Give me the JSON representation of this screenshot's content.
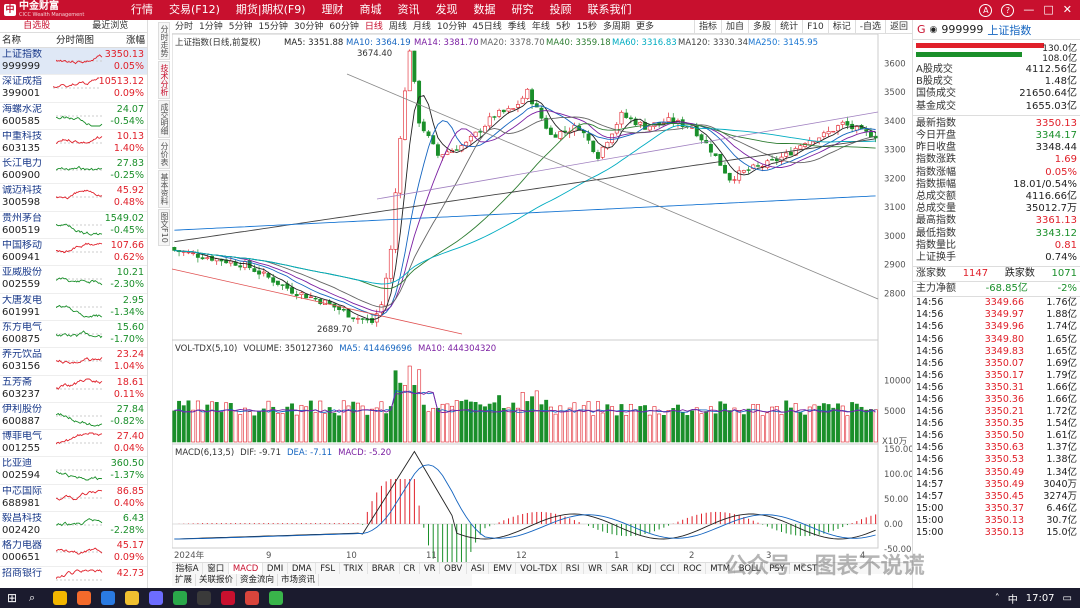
{
  "app": {
    "logo_text": "中金财富",
    "logo_sub": "CICC Wealth Management"
  },
  "menu": [
    "行情",
    "交易(F12)",
    "期货|期权(F9)",
    "理财",
    "商城",
    "资讯",
    "发现",
    "数据",
    "研究",
    "投顾",
    "联系我们"
  ],
  "window_controls": [
    "A",
    "?",
    "—",
    "□",
    "✕"
  ],
  "left": {
    "tabs": [
      "自选股",
      "最近浏览"
    ],
    "headers": [
      "名称",
      "分时简图",
      "涨幅"
    ],
    "rows": [
      {
        "name": "上证指数",
        "code": "999999",
        "price": "3350.13",
        "chg": "0.05%",
        "dir": "up",
        "sel": true
      },
      {
        "name": "深证成指",
        "code": "399001",
        "price": "10513.12",
        "chg": "0.09%",
        "dir": "up"
      },
      {
        "name": "海螺水泥",
        "code": "600585",
        "price": "24.07",
        "chg": "-0.54%",
        "dir": "dn"
      },
      {
        "name": "中重科技",
        "code": "603135",
        "price": "10.13",
        "chg": "1.40%",
        "dir": "up"
      },
      {
        "name": "长江电力",
        "code": "600900",
        "price": "27.83",
        "chg": "-0.25%",
        "dir": "dn"
      },
      {
        "name": "诚迈科技",
        "code": "300598",
        "price": "45.92",
        "chg": "0.48%",
        "dir": "up"
      },
      {
        "name": "贵州茅台",
        "code": "600519",
        "price": "1549.02",
        "chg": "-0.45%",
        "dir": "dn"
      },
      {
        "name": "中国移动",
        "code": "600941",
        "price": "107.66",
        "chg": "0.62%",
        "dir": "up"
      },
      {
        "name": "亚威股份",
        "code": "002559",
        "price": "10.21",
        "chg": "-2.30%",
        "dir": "dn"
      },
      {
        "name": "大唐发电",
        "code": "601991",
        "price": "2.95",
        "chg": "-1.34%",
        "dir": "dn"
      },
      {
        "name": "东方电气",
        "code": "600875",
        "price": "15.60",
        "chg": "-1.70%",
        "dir": "dn"
      },
      {
        "name": "养元饮品",
        "code": "603156",
        "price": "23.24",
        "chg": "1.04%",
        "dir": "up"
      },
      {
        "name": "五芳斋",
        "code": "603237",
        "price": "18.61",
        "chg": "0.11%",
        "dir": "up"
      },
      {
        "name": "伊利股份",
        "code": "600887",
        "price": "27.84",
        "chg": "-0.82%",
        "dir": "dn"
      },
      {
        "name": "博菲电气",
        "code": "001255",
        "price": "27.40",
        "chg": "0.04%",
        "dir": "up"
      },
      {
        "name": "比亚迪",
        "code": "002594",
        "price": "360.50",
        "chg": "-1.37%",
        "dir": "dn"
      },
      {
        "name": "中芯国际",
        "code": "688981",
        "price": "86.85",
        "chg": "0.40%",
        "dir": "up"
      },
      {
        "name": "毅昌科技",
        "code": "002420",
        "price": "6.43",
        "chg": "-2.28%",
        "dir": "dn"
      },
      {
        "name": "格力电器",
        "code": "000651",
        "price": "45.17",
        "chg": "0.09%",
        "dir": "up"
      },
      {
        "name": "招商银行",
        "code": "",
        "price": "42.73",
        "chg": "",
        "dir": "up"
      }
    ]
  },
  "vtabs": [
    "分时走势",
    "技术分析",
    "成交明细",
    "分价表",
    "基本资料",
    "图文F10"
  ],
  "chart_toolbar": {
    "periods": [
      "分时",
      "1分钟",
      "5分钟",
      "15分钟",
      "30分钟",
      "60分钟",
      "日线",
      "周线",
      "月线",
      "10分钟",
      "45日线",
      "季线",
      "年线",
      "5秒",
      "15秒",
      "多周期",
      "更多"
    ],
    "active_period": "日线",
    "tools": [
      "指标",
      "加自",
      "多股",
      "统计",
      "F10",
      "标记",
      "-自选",
      "返回"
    ]
  },
  "main_chart": {
    "header": "上证指数(日线,前复权)",
    "ma": [
      {
        "label": "MA5: 3351.88",
        "color": "#222222"
      },
      {
        "label": "MA10: 3364.19",
        "color": "#1565c0"
      },
      {
        "label": "MA14: 3381.70",
        "color": "#7b1fa2"
      },
      {
        "label": "MA20: 3378.70",
        "color": "#666666"
      },
      {
        "label": "MA40: 3359.18",
        "color": "#2e7d32"
      },
      {
        "label": "MA60: 3316.83",
        "color": "#00acc1"
      },
      {
        "label": "MA120: 3330.34",
        "color": "#444444"
      },
      {
        "label": "MA250: 3145.95",
        "color": "#1976d2"
      }
    ],
    "y_ticks": [
      "3600",
      "3500",
      "3400",
      "3300",
      "3200",
      "3100",
      "3000",
      "2900",
      "2800"
    ],
    "high_label": "3674.40",
    "low_label": "2689.70"
  },
  "vol_chart": {
    "header": "VOL-TDX(5,10)",
    "volume": "VOLUME: 350127360",
    "ma5": "MA5: 414469696",
    "ma10": "MA10: 444304320",
    "y_ticks": [
      "10000",
      "5000"
    ],
    "unit": "X10万"
  },
  "macd_chart": {
    "header": "MACD(6,13,5)",
    "dif": "DIF: -9.71",
    "dea": "DEA: -7.11",
    "macd": "MACD: -5.20",
    "y_ticks": [
      "150.00",
      "100.00",
      "50.00",
      "0.00",
      "-50.00"
    ]
  },
  "x_labels": [
    "2024年",
    "9",
    "10",
    "11",
    "12",
    "1",
    "2",
    "3",
    "4"
  ],
  "indicator_tabs": [
    "指标A",
    "窗口",
    "MACD",
    "DMI",
    "DMA",
    "FSL",
    "TRIX",
    "BRAR",
    "CR",
    "VR",
    "OBV",
    "ASI",
    "EMV",
    "VOL-TDX",
    "RSI",
    "WR",
    "SAR",
    "KDJ",
    "CCI",
    "ROC",
    "MTM",
    "BOLL",
    "PSY",
    "MCST"
  ],
  "active_indicator": "MACD",
  "indicator_tabs2": [
    "扩展",
    "关联报价",
    "资金流向",
    "市场资讯"
  ],
  "right": {
    "code": "999999",
    "name": "上证指数",
    "bar_vals": [
      "130.0亿",
      "108.0亿"
    ],
    "kv1": [
      {
        "k": "A股成交",
        "v": "4112.56亿",
        "c": "n"
      },
      {
        "k": "B股成交",
        "v": "1.48亿",
        "c": "n"
      },
      {
        "k": "国债成交",
        "v": "21650.64亿",
        "c": "n"
      },
      {
        "k": "基金成交",
        "v": "1655.03亿",
        "c": "n"
      }
    ],
    "kv2": [
      {
        "k": "最新指数",
        "v": "3350.13",
        "c": "up"
      },
      {
        "k": "今日开盘",
        "v": "3344.17",
        "c": "dn"
      },
      {
        "k": "昨日收盘",
        "v": "3348.44",
        "c": "n"
      },
      {
        "k": "指数涨跌",
        "v": "1.69",
        "c": "up"
      },
      {
        "k": "指数涨幅",
        "v": "0.05%",
        "c": "up"
      },
      {
        "k": "指数振幅",
        "v": "18.01/0.54%",
        "c": "n"
      },
      {
        "k": "总成交额",
        "v": "4116.66亿",
        "c": "n"
      },
      {
        "k": "总成交量",
        "v": "35012.7万",
        "c": "n"
      },
      {
        "k": "最高指数",
        "v": "3361.13",
        "c": "up"
      },
      {
        "k": "最低指数",
        "v": "3343.12",
        "c": "dn"
      },
      {
        "k": "指数量比",
        "v": "0.81",
        "c": "up"
      },
      {
        "k": "上证换手",
        "v": "0.74%",
        "c": "n"
      }
    ],
    "updown": {
      "up_label": "涨家数",
      "up": "1147",
      "dn_label": "跌家数",
      "dn": "1071"
    },
    "flow": {
      "label": "主力净额",
      "value": "-68.85亿",
      "pct": "-2%"
    },
    "ticks": [
      {
        "t": "14:56",
        "p": "3349.66",
        "v": "1.76亿",
        "c": "up"
      },
      {
        "t": "14:56",
        "p": "3349.97",
        "v": "1.88亿",
        "c": "up"
      },
      {
        "t": "14:56",
        "p": "3349.96",
        "v": "1.74亿",
        "c": "up"
      },
      {
        "t": "14:56",
        "p": "3349.80",
        "v": "1.65亿",
        "c": "up"
      },
      {
        "t": "14:56",
        "p": "3349.83",
        "v": "1.65亿",
        "c": "up"
      },
      {
        "t": "14:56",
        "p": "3350.07",
        "v": "1.69亿",
        "c": "up"
      },
      {
        "t": "14:56",
        "p": "3350.17",
        "v": "1.79亿",
        "c": "up"
      },
      {
        "t": "14:56",
        "p": "3350.31",
        "v": "1.66亿",
        "c": "up"
      },
      {
        "t": "14:56",
        "p": "3350.36",
        "v": "1.66亿",
        "c": "up"
      },
      {
        "t": "14:56",
        "p": "3350.21",
        "v": "1.72亿",
        "c": "up"
      },
      {
        "t": "14:56",
        "p": "3350.35",
        "v": "1.54亿",
        "c": "up"
      },
      {
        "t": "14:56",
        "p": "3350.50",
        "v": "1.61亿",
        "c": "up"
      },
      {
        "t": "14:56",
        "p": "3350.63",
        "v": "1.37亿",
        "c": "up"
      },
      {
        "t": "14:56",
        "p": "3350.53",
        "v": "1.38亿",
        "c": "up"
      },
      {
        "t": "14:56",
        "p": "3350.49",
        "v": "1.34亿",
        "c": "up"
      },
      {
        "t": "14:57",
        "p": "3350.49",
        "v": "3040万",
        "c": "up"
      },
      {
        "t": "14:57",
        "p": "3350.45",
        "v": "3274万",
        "c": "up"
      },
      {
        "t": "15:00",
        "p": "3350.37",
        "v": "6.46亿",
        "c": "up"
      },
      {
        "t": "15:00",
        "p": "3350.13",
        "v": "30.7亿",
        "c": "up"
      },
      {
        "t": "15:00",
        "p": "3350.13",
        "v": "15.0亿",
        "c": "up"
      }
    ]
  },
  "watermark": "公众号 · 图表不说谎",
  "taskbar": {
    "time": "17:07",
    "lang": "中"
  }
}
